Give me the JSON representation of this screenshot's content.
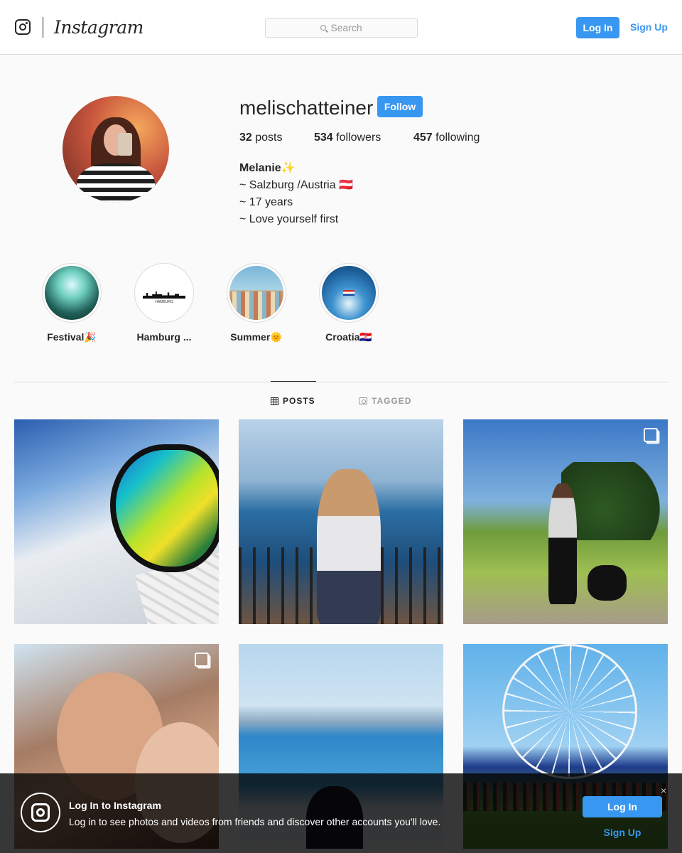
{
  "header": {
    "brand": "Instagram",
    "search_placeholder": "Search",
    "login_label": "Log In",
    "signup_label": "Sign Up"
  },
  "profile": {
    "username": "melischatteiner",
    "follow_label": "Follow",
    "stats": {
      "posts_count": "32",
      "posts_label": "posts",
      "followers_count": "534",
      "followers_label": "followers",
      "following_count": "457",
      "following_label": "following"
    },
    "bio": {
      "name": "Melanie✨",
      "lines": [
        "~ Salzburg /Austria 🇦🇹",
        "~ 17 years",
        "~ Love yourself first"
      ]
    }
  },
  "highlights": [
    {
      "label": "Festival🎉"
    },
    {
      "label": "Hamburg ..."
    },
    {
      "label": "Summer🌞"
    },
    {
      "label": "Croatia🇭🇷"
    }
  ],
  "hamburg_caption": "HAMBURG",
  "tabs": [
    {
      "label": "POSTS",
      "active": true
    },
    {
      "label": "TAGGED",
      "active": false
    }
  ],
  "posts_count_visible": 6,
  "banner": {
    "title": "Log In to Instagram",
    "text": "Log in to see photos and videos from friends and discover other accounts you'll love.",
    "login_label": "Log In",
    "signup_label": "Sign Up",
    "close_glyph": "×"
  },
  "colors": {
    "accent": "#3897f0",
    "border": "#dbdbdb",
    "background": "#fafafa"
  }
}
